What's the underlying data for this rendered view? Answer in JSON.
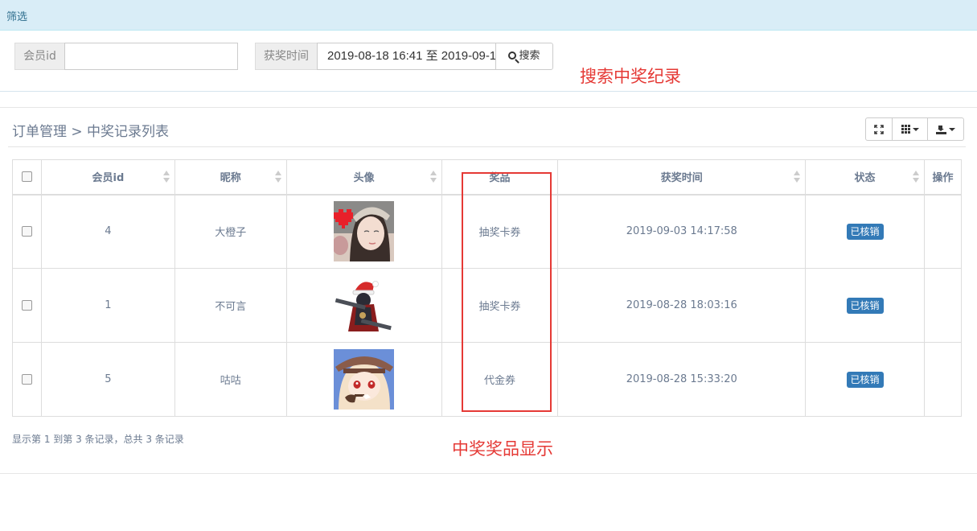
{
  "filter": {
    "title": "筛选"
  },
  "search": {
    "member_label": "会员id",
    "member_value": "",
    "time_label": "获奖时间",
    "time_value": "2019-08-18 16:41 至 2019-09-1",
    "button_label": "搜索"
  },
  "annotations": {
    "search_note": "搜索中奖纪录",
    "prize_note": "中奖奖品显示"
  },
  "breadcrumb": "订单管理 > 中奖记录列表",
  "table": {
    "headers": [
      "会员id",
      "昵称",
      "头像",
      "奖品",
      "获奖时间",
      "状态",
      "操作"
    ],
    "rows": [
      {
        "member_id": "4",
        "nickname": "大橙子",
        "avatar": "avatar-girl",
        "prize": "抽奖卡券",
        "time": "2019-09-03 14:17:58",
        "status": "已核销"
      },
      {
        "member_id": "1",
        "nickname": "不可言",
        "avatar": "avatar-chibi-santa",
        "prize": "抽奖卡券",
        "time": "2019-08-28 18:03:16",
        "status": "已核销"
      },
      {
        "member_id": "5",
        "nickname": "咕咕",
        "avatar": "avatar-anime-detective",
        "prize": "代金券",
        "time": "2019-08-28 15:33:20",
        "status": "已核销"
      }
    ]
  },
  "pagination_info": "显示第 1 到第 3 条记录，总共 3 条记录",
  "colors": {
    "accent": "#337ab7",
    "annotation": "#e53935",
    "filter_bg": "#d9edf7"
  }
}
